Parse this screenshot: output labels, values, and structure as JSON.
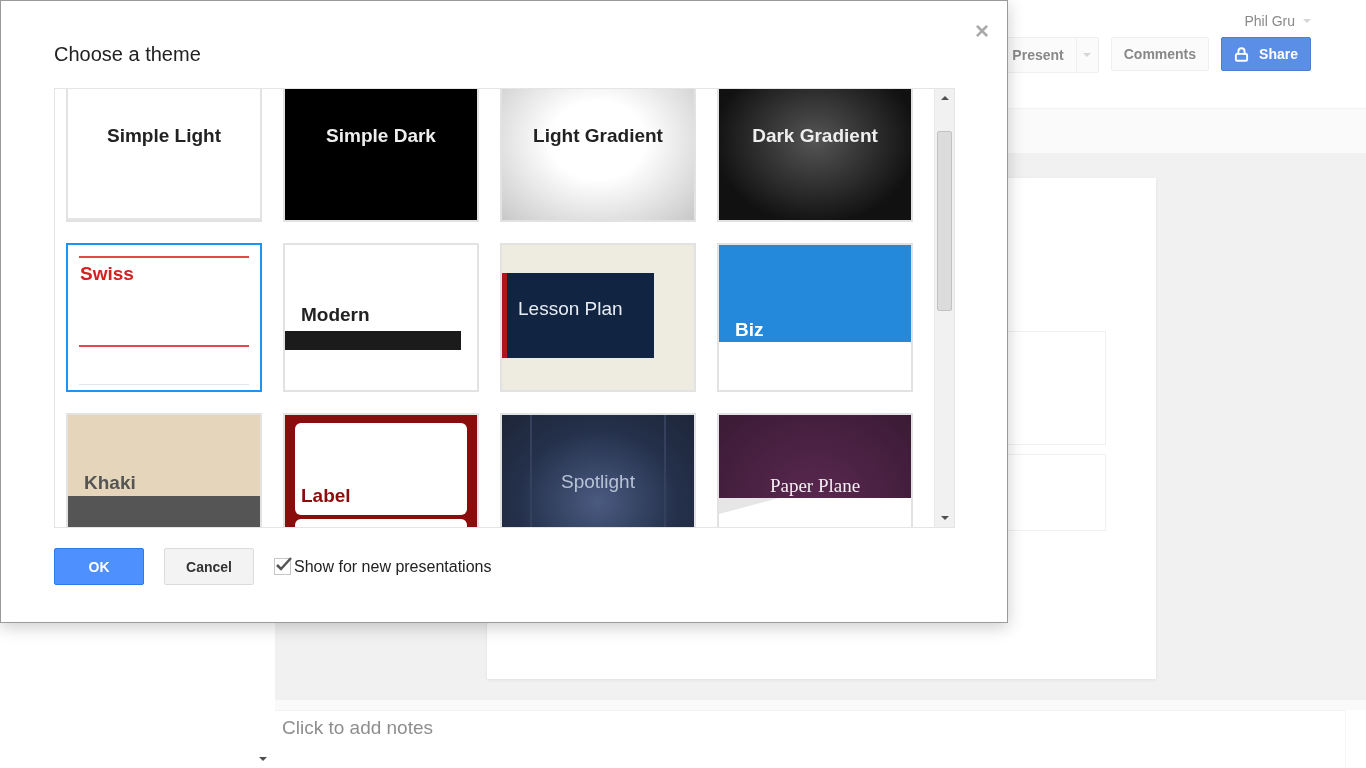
{
  "header": {
    "user": "Phil Gru",
    "buttons": [
      {
        "label": "Present",
        "kind": "split"
      },
      {
        "label": "Comments",
        "kind": "plain"
      },
      {
        "label": "Share",
        "kind": "share"
      }
    ]
  },
  "notes": {
    "placeholder": "Click to add notes"
  },
  "dialog": {
    "title": "Choose a theme",
    "close": "×",
    "themes": [
      {
        "name": "Simple Light",
        "kind": "simple-light",
        "selected": false
      },
      {
        "name": "Simple Dark",
        "kind": "simple-dark",
        "selected": false
      },
      {
        "name": "Light Gradient",
        "kind": "light-gradient",
        "selected": false
      },
      {
        "name": "Dark Gradient",
        "kind": "dark-gradient",
        "selected": false
      },
      {
        "name": "Swiss",
        "kind": "swiss",
        "selected": true
      },
      {
        "name": "Modern",
        "kind": "modern",
        "selected": false
      },
      {
        "name": "Lesson Plan",
        "kind": "lesson-plan",
        "selected": false
      },
      {
        "name": "Biz",
        "kind": "biz",
        "selected": false
      },
      {
        "name": "Khaki",
        "kind": "khaki",
        "selected": false
      },
      {
        "name": "Label",
        "kind": "label",
        "selected": false
      },
      {
        "name": "Spotlight",
        "kind": "spotlight",
        "selected": false
      },
      {
        "name": "Paper Plane",
        "kind": "paper-plane",
        "selected": false
      }
    ],
    "ok": "OK",
    "cancel": "Cancel",
    "show_for_new": {
      "label": "Show for new presentations",
      "checked": true
    }
  }
}
